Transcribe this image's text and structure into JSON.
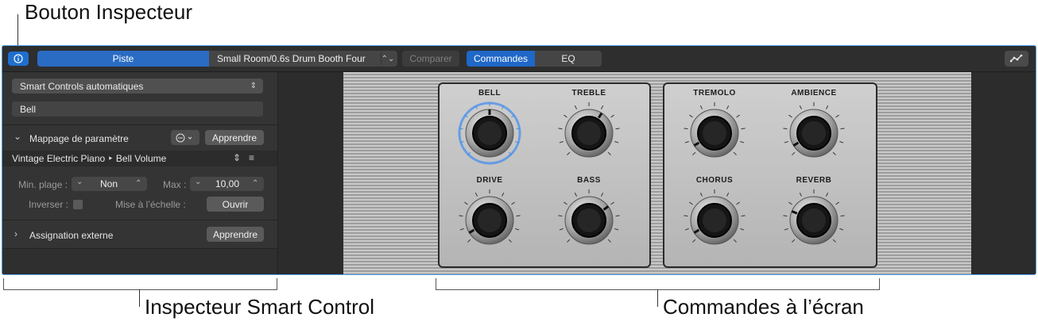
{
  "callouts": {
    "inspector_button": "Bouton Inspecteur",
    "smart_control_inspector": "Inspecteur Smart Control",
    "onscreen_controls": "Commandes à l’écran"
  },
  "toolbar": {
    "track_tab": "Piste",
    "preset_name": "Small Room/0.6s Drum Booth Four",
    "compare_label": "Comparer",
    "controls_tab": "Commandes",
    "eq_tab": "EQ"
  },
  "inspector": {
    "smart_controls_mode": "Smart Controls automatiques",
    "control_name": "Bell",
    "param_mapping_label": "Mappage de paramètre",
    "learn_label": "Apprendre",
    "mapping_target": "Vintage Electric Piano ‣ Bell Volume",
    "min_range_label": "Min. plage :",
    "min_range_value": "Non",
    "max_label": "Max :",
    "max_value": "10,00",
    "invert_label": "Inverser :",
    "scaling_label": "Mise à l’échelle :",
    "open_label": "Ouvrir",
    "external_assign_label": "Assignation externe",
    "external_learn_label": "Apprendre"
  },
  "controls": {
    "panel_left": [
      {
        "label": "BELL",
        "value": 0.5,
        "selected": true
      },
      {
        "label": "TREBLE",
        "value": 0.62,
        "selected": false
      },
      {
        "label": "DRIVE",
        "value": 0.05,
        "selected": false
      },
      {
        "label": "BASS",
        "value": 0.7,
        "selected": false
      }
    ],
    "panel_right": [
      {
        "label": "TREMOLO",
        "value": 0.05,
        "selected": false
      },
      {
        "label": "AMBIENCE",
        "value": 0.05,
        "selected": false
      },
      {
        "label": "CHORUS",
        "value": 0.05,
        "selected": false
      },
      {
        "label": "REVERB",
        "value": 0.25,
        "selected": false
      }
    ]
  },
  "colors": {
    "accent": "#1f67c8",
    "selection_glow": "#3d8af0"
  }
}
